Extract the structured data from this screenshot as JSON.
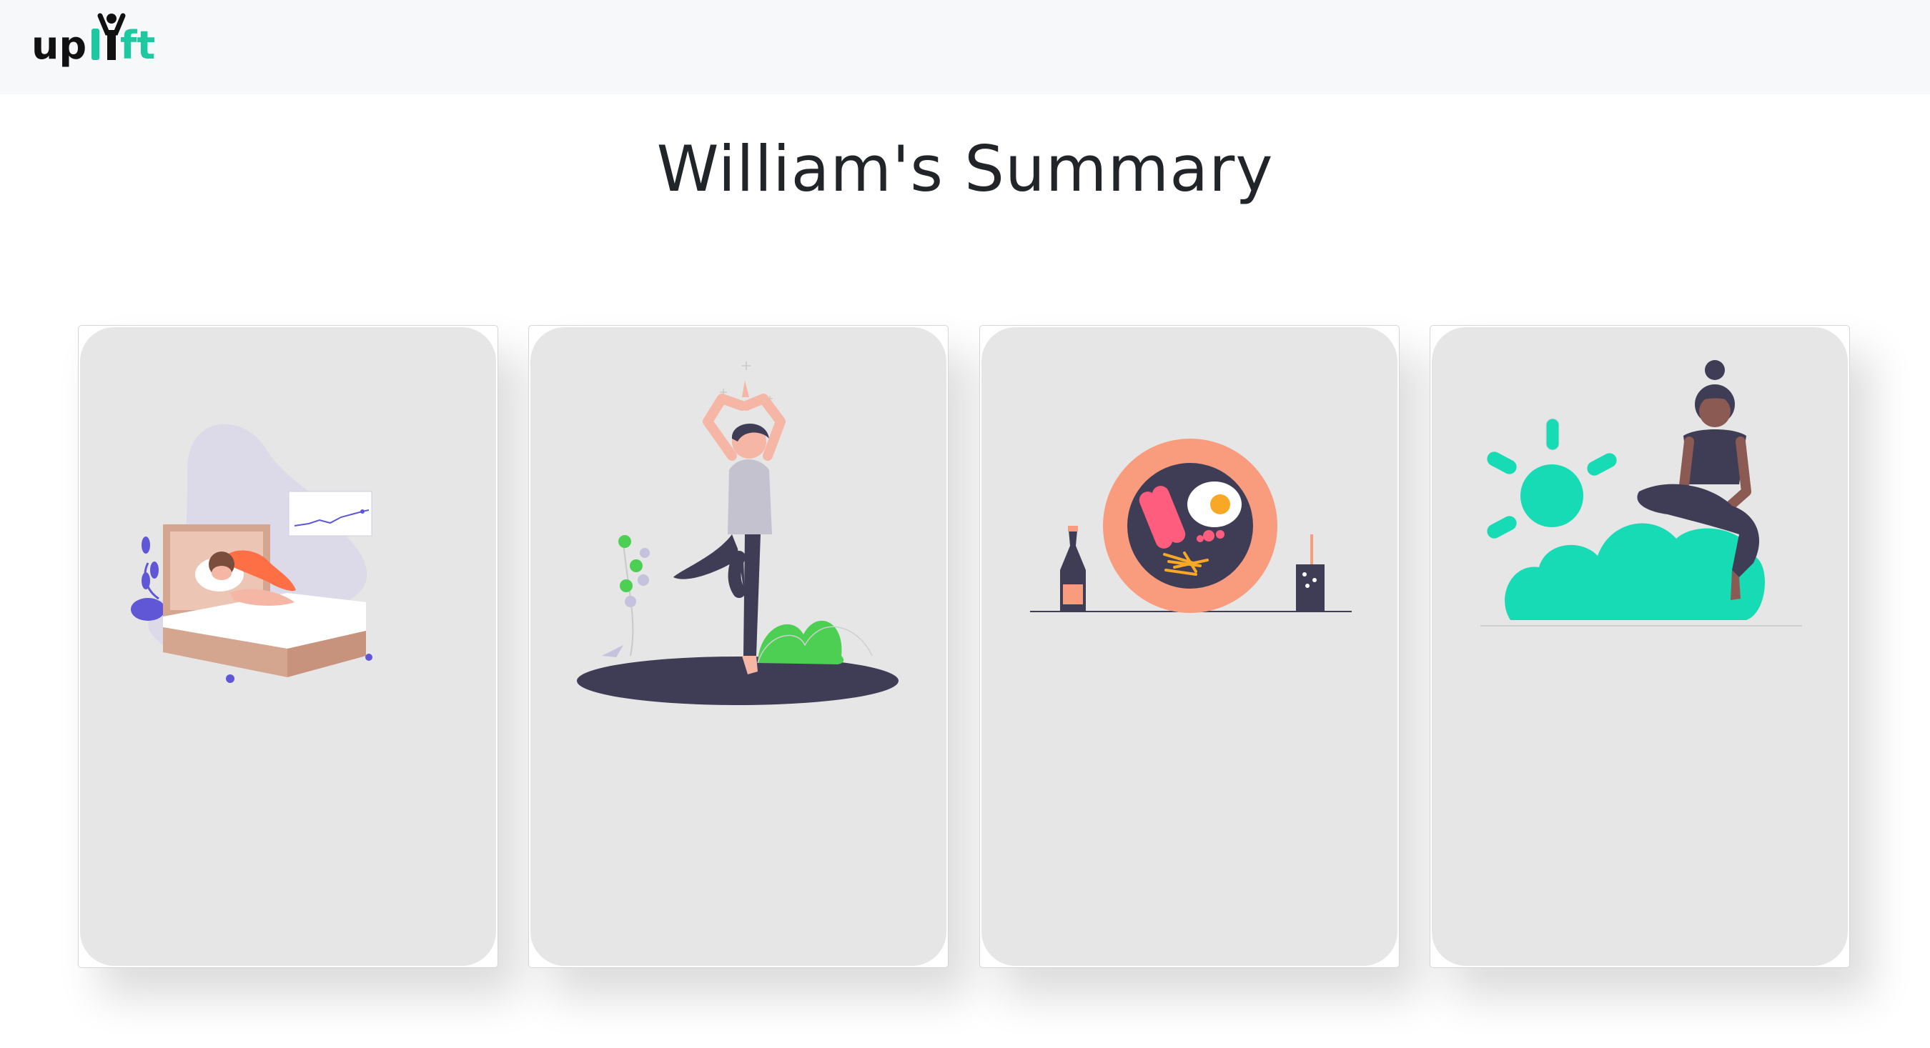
{
  "navbar": {
    "logo_text": "uplift",
    "logo_colors": {
      "dark": "#111111",
      "accent": "#1ec8a0"
    }
  },
  "page": {
    "title": "William's Summary"
  },
  "cards": [
    {
      "topic": "sleep",
      "illustration": "sleeping-person-illustration"
    },
    {
      "topic": "exercise",
      "illustration": "yoga-pose-illustration"
    },
    {
      "topic": "food",
      "illustration": "breakfast-plate-illustration"
    },
    {
      "topic": "mood",
      "illustration": "woman-on-cloud-illustration"
    }
  ],
  "colors": {
    "card_bg": "#e6e6e6",
    "teal": "#17dbb4",
    "purple": "#5f57d6",
    "salmon": "#f99b7d",
    "dark": "#3f3d56"
  }
}
